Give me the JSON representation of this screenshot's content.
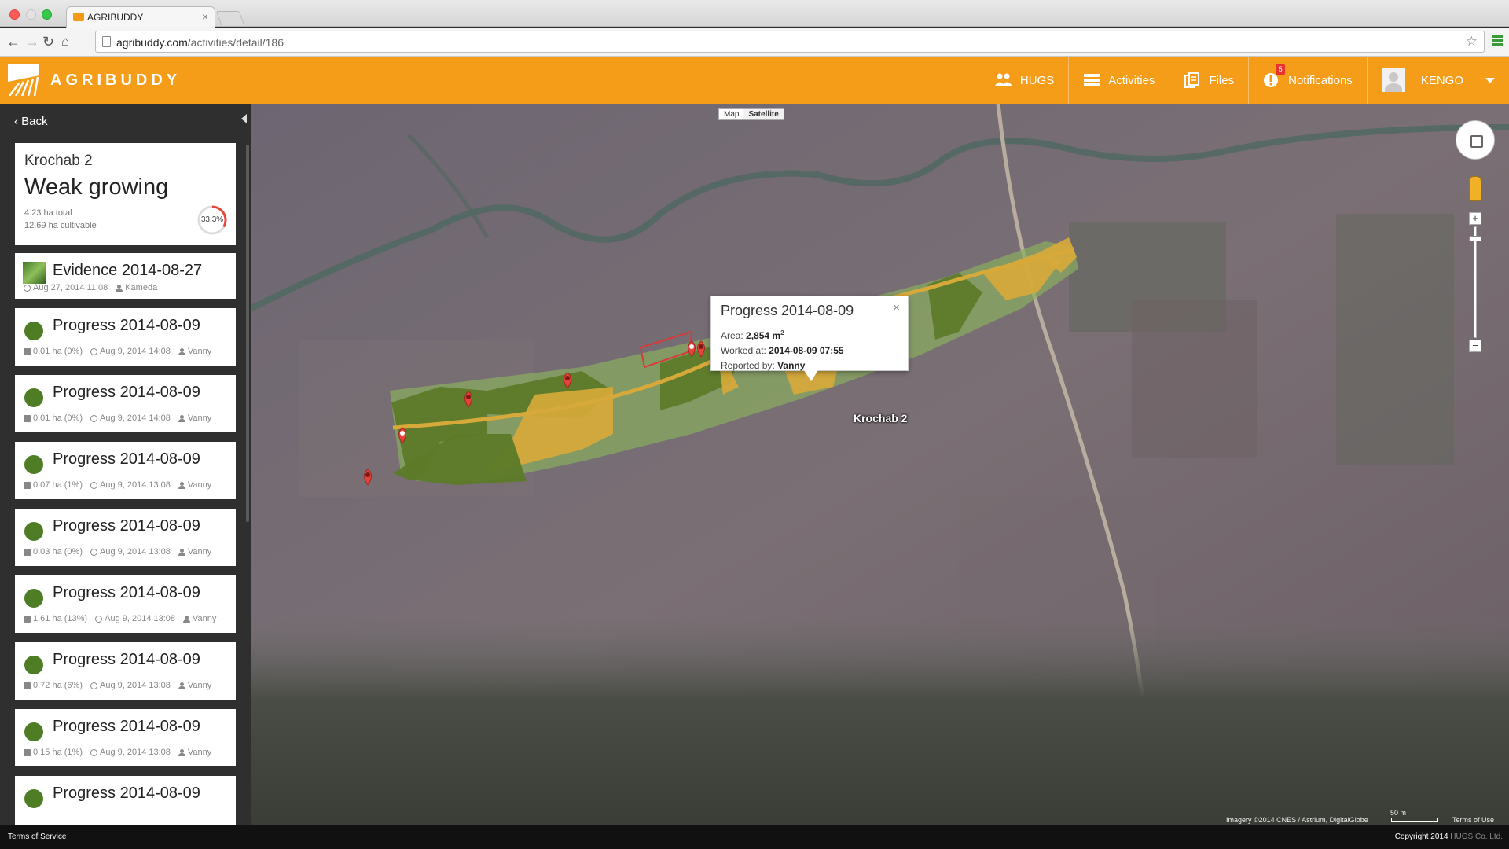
{
  "browser": {
    "tab_title": "AGRIBUDDY",
    "tab_close": "×",
    "url_host": "agribuddy.com",
    "url_path": "/activities/detail/186"
  },
  "app": {
    "brand": "AGRIBUDDY",
    "brand_color": "#f59c18",
    "nav": {
      "hugs": "HUGS",
      "activities": "Activities",
      "files": "Files",
      "notifications": "Notifications",
      "notification_count": "5",
      "user": "KENGO"
    }
  },
  "sidebar": {
    "back_label": "Back",
    "summary": {
      "name": "Krochab 2",
      "status": "Weak growing",
      "total": "4.23 ha total",
      "cultivable": "12.69 ha cultivable",
      "progress_label": "33.3%",
      "progress_fraction": 0.333
    },
    "evidence": {
      "title": "Evidence 2014-08-27",
      "time": "Aug 27, 2014 11:08",
      "user": "Kameda"
    },
    "activities": [
      {
        "title": "Progress 2014-08-09",
        "area": "0.01 ha (0%)",
        "time": "Aug 9, 2014 14:08",
        "user": "Vanny"
      },
      {
        "title": "Progress 2014-08-09",
        "area": "0.01 ha (0%)",
        "time": "Aug 9, 2014 14:08",
        "user": "Vanny"
      },
      {
        "title": "Progress 2014-08-09",
        "area": "0.07 ha (1%)",
        "time": "Aug 9, 2014 13:08",
        "user": "Vanny"
      },
      {
        "title": "Progress 2014-08-09",
        "area": "0.03 ha (0%)",
        "time": "Aug 9, 2014 13:08",
        "user": "Vanny"
      },
      {
        "title": "Progress 2014-08-09",
        "area": "1.61 ha (13%)",
        "time": "Aug 9, 2014 13:08",
        "user": "Vanny"
      },
      {
        "title": "Progress 2014-08-09",
        "area": "0.72 ha (6%)",
        "time": "Aug 9, 2014 13:08",
        "user": "Vanny"
      },
      {
        "title": "Progress 2014-08-09",
        "area": "0.15 ha (1%)",
        "time": "Aug 9, 2014 13:08",
        "user": "Vanny"
      },
      {
        "title": "Progress 2014-08-09",
        "area": "",
        "time": "",
        "user": ""
      }
    ]
  },
  "map": {
    "type_map": "Map",
    "type_satellite": "Satellite",
    "field_label": "Krochab 2",
    "popup": {
      "title": "Progress 2014-08-09",
      "close": "×",
      "area_label": "Area:",
      "area_value": "2,854 m",
      "area_unit_sup": "2",
      "worked_label": "Worked at:",
      "worked_value": "2014-08-09 07:55",
      "reported_label": "Reported by:",
      "reported_value": "Vanny"
    },
    "zoom_in": "+",
    "zoom_out": "−",
    "attribution": "Imagery ©2014 CNES / Astrium, DigitalGlobe",
    "scale": "50 m",
    "terms": "Terms of Use"
  },
  "footer": {
    "terms": "Terms of Service",
    "copyright": "Copyright 2014",
    "company": "HUGS Co. Ltd."
  }
}
